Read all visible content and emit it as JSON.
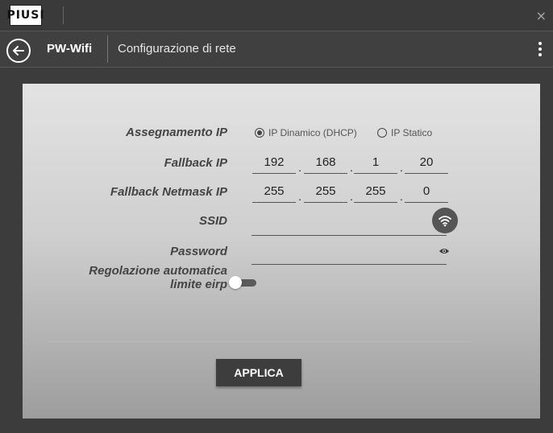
{
  "window": {
    "logo_text": "PIUSI",
    "close_glyph": "×"
  },
  "appbar": {
    "app_name": "PW-Wifi",
    "section_title": "Configurazione di rete"
  },
  "form": {
    "ip_assignment": {
      "label": "Assegnamento IP",
      "options": [
        {
          "label": "IP Dinamico (DHCP)",
          "selected": true
        },
        {
          "label": "IP Statico",
          "selected": false
        }
      ]
    },
    "fallback_ip": {
      "label": "Fallback IP",
      "octets": [
        "192",
        "168",
        "1",
        "20"
      ]
    },
    "fallback_netmask": {
      "label": "Fallback Netmask IP",
      "octets": [
        "255",
        "255",
        "255",
        "0"
      ]
    },
    "ssid": {
      "label": "SSID",
      "value": ""
    },
    "password": {
      "label": "Password",
      "value": ""
    },
    "auto_eirp": {
      "label_line1": "Regolazione automatica",
      "label_line2": "limite eirp",
      "enabled": false
    }
  },
  "actions": {
    "apply_label": "APPLICA"
  },
  "icons": [
    "back-arrow-icon",
    "kebab-menu-icon",
    "wifi-icon",
    "eye-icon",
    "close-icon"
  ]
}
